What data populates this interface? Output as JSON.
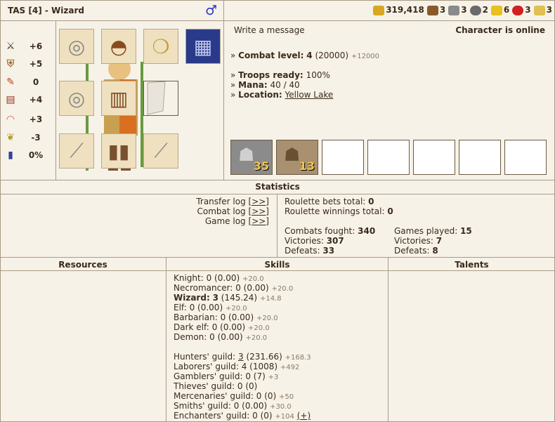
{
  "header": {
    "title": "TAS  [4] - Wizard",
    "gender_symbol": "♂"
  },
  "resources_bar": [
    {
      "icon": "gold-icon",
      "value": "319,418",
      "color": "#d8a820"
    },
    {
      "icon": "wood-icon",
      "value": "3",
      "color": "#8a5a2a"
    },
    {
      "icon": "ore-icon",
      "value": "3",
      "color": "#8a8a8a"
    },
    {
      "icon": "mercury-icon",
      "value": "2",
      "color": "#6a6a6a"
    },
    {
      "icon": "sulfur-icon",
      "value": "6",
      "color": "#e8c020"
    },
    {
      "icon": "crystal-icon",
      "value": "3",
      "color": "#d02020"
    },
    {
      "icon": "gems-icon",
      "value": "3",
      "color": "#e0c050"
    }
  ],
  "stats": [
    {
      "icon": "attack-icon",
      "value": "+6"
    },
    {
      "icon": "defense-icon",
      "value": "+5"
    },
    {
      "icon": "spellpower-icon",
      "value": "0"
    },
    {
      "icon": "knowledge-icon",
      "value": "+4"
    },
    {
      "icon": "luck-icon",
      "value": "+3"
    },
    {
      "icon": "morale-icon",
      "value": "-3"
    },
    {
      "icon": "initiative-icon",
      "value": "0%"
    }
  ],
  "message": {
    "write": "Write a message",
    "online": "Character is online"
  },
  "info": {
    "combat_label": "Combat level:",
    "combat_value": "4",
    "combat_exp": "(20000)",
    "combat_next": "+12000",
    "troops_label": "Troops ready:",
    "troops_value": "100%",
    "mana_label": "Mana:",
    "mana_value": "40 / 40",
    "location_label": "Location:",
    "location_value": "Yellow Lake",
    "bullet": "»"
  },
  "units": [
    {
      "count": "35"
    },
    {
      "count": "13"
    }
  ],
  "statistics": {
    "head": "Statistics",
    "transfer_log": "Transfer log",
    "combat_log": "Combat log",
    "game_log": "Game log",
    "link": "[>>]",
    "roulette_bets_label": "Roulette bets total:",
    "roulette_bets_value": "0",
    "roulette_win_label": "Roulette winnings total:",
    "roulette_win_value": "0",
    "combats_label": "Combats fought:",
    "combats_value": "340",
    "victories_label": "Victories:",
    "victories_value": "307",
    "defeats_label": "Defeats:",
    "defeats_value": "33",
    "games_label": "Games played:",
    "games_value": "15",
    "g_victories_label": "Victories:",
    "g_victories_value": "7",
    "g_defeats_label": "Defeats:",
    "g_defeats_value": "8"
  },
  "columns": {
    "resources": "Resources",
    "skills": "Skills",
    "talents": "Talents"
  },
  "skills": [
    {
      "name": "Knight:",
      "value": "0 (0.00)",
      "extra": "+20.0",
      "bold": false
    },
    {
      "name": "Necromancer:",
      "value": "0 (0.00)",
      "extra": "+20.0",
      "bold": false
    },
    {
      "name": "Wizard:",
      "value": "3",
      "value2": "(145.24)",
      "extra": "+14.8",
      "bold": true
    },
    {
      "name": "Elf:",
      "value": "0 (0.00)",
      "extra": "+20.0",
      "bold": false
    },
    {
      "name": "Barbarian:",
      "value": "0 (0.00)",
      "extra": "+20.0",
      "bold": false
    },
    {
      "name": "Dark elf:",
      "value": "0 (0.00)",
      "extra": "+20.0",
      "bold": false
    },
    {
      "name": "Demon:",
      "value": "0 (0.00)",
      "extra": "+20.0",
      "bold": false
    }
  ],
  "guilds": [
    {
      "name": "Hunters' guild:",
      "link": "3",
      "value": "(231.66)",
      "extra": "+168.3"
    },
    {
      "name": "Laborers' guild:",
      "value": "4 (1008)",
      "extra": "+492"
    },
    {
      "name": "Gamblers' guild:",
      "value": "0 (7)",
      "extra": "+3"
    },
    {
      "name": "Thieves' guild:",
      "value": "0 (0)",
      "extra": ""
    },
    {
      "name": "Mercenaries' guild:",
      "value": "0 (0)",
      "extra": "+50"
    },
    {
      "name": "Smiths' guild:",
      "value": "0 (0.00)",
      "extra": "+30.0"
    },
    {
      "name": "Enchanters' guild:",
      "value": "0 (0)",
      "extra": "+104",
      "plus": "(+)"
    }
  ]
}
